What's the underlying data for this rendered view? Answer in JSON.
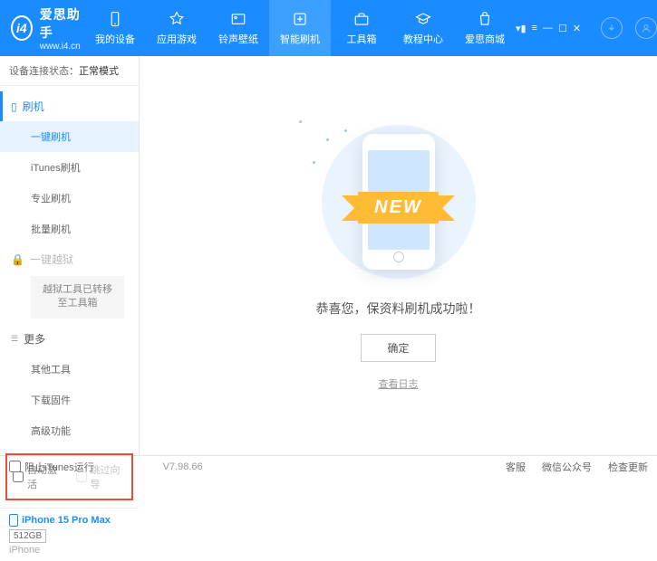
{
  "app": {
    "name": "爱思助手",
    "url": "www.i4.cn"
  },
  "topnav": [
    {
      "label": "我的设备"
    },
    {
      "label": "应用游戏"
    },
    {
      "label": "铃声壁纸"
    },
    {
      "label": "智能刷机"
    },
    {
      "label": "工具箱"
    },
    {
      "label": "教程中心"
    },
    {
      "label": "爱思商城"
    }
  ],
  "conn": {
    "label": "设备连接状态：",
    "status": "正常模式"
  },
  "side": {
    "flash": {
      "header": "刷机",
      "items": [
        "一键刷机",
        "iTunes刷机",
        "专业刷机",
        "批量刷机"
      ]
    },
    "jailbreak": {
      "header": "一键越狱",
      "note": "越狱工具已转移至工具箱"
    },
    "more": {
      "header": "更多",
      "items": [
        "其他工具",
        "下载固件",
        "高级功能"
      ]
    }
  },
  "checks": {
    "auto_activate": "自动激活",
    "skip_guide": "跳过向导"
  },
  "device": {
    "name": "iPhone 15 Pro Max",
    "storage": "512GB",
    "type": "iPhone"
  },
  "main": {
    "ribbon": "NEW",
    "message": "恭喜您，保资料刷机成功啦！",
    "ok": "确定",
    "log": "查看日志"
  },
  "footer": {
    "block_itunes": "阻止iTunes运行",
    "version": "V7.98.66",
    "links": [
      "客服",
      "微信公众号",
      "检查更新"
    ]
  }
}
